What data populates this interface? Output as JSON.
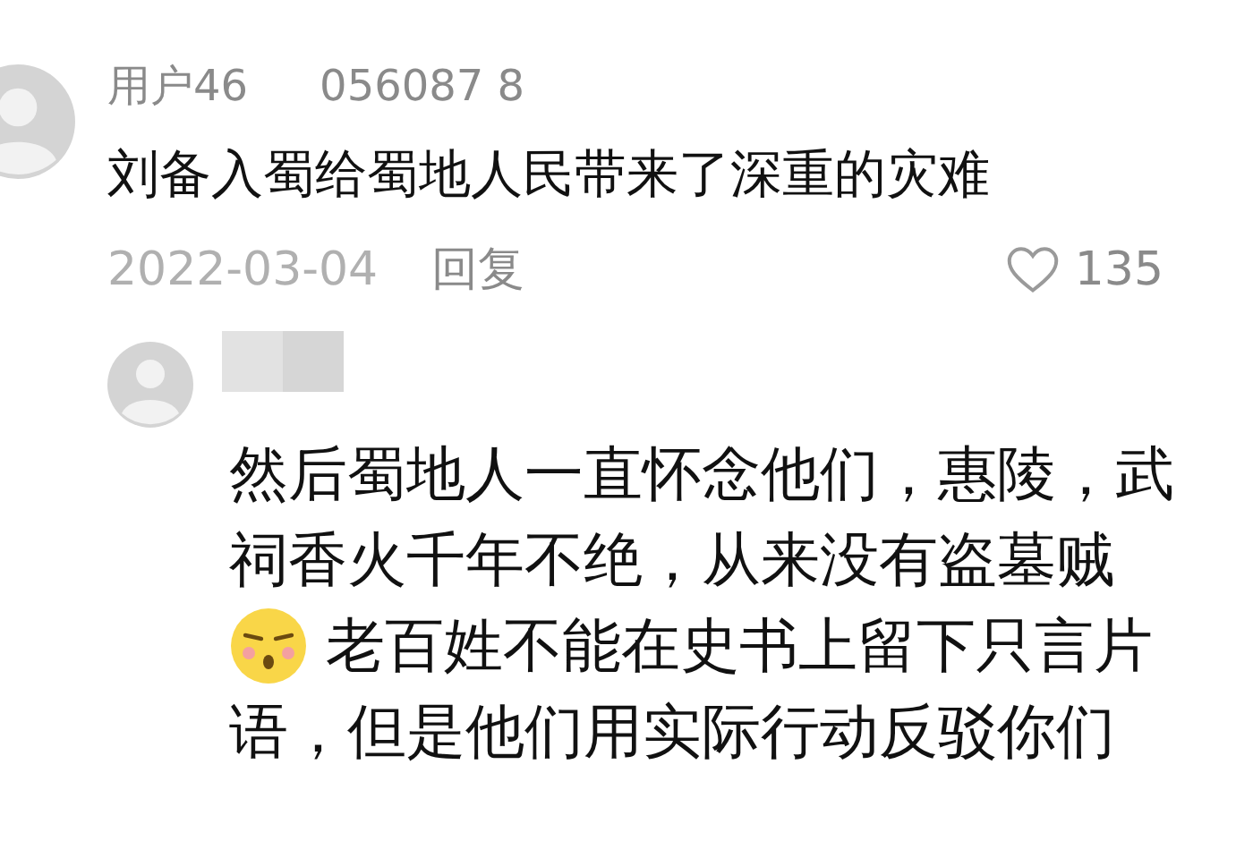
{
  "comment": {
    "username": "用户46",
    "meta": "056087 8",
    "text": "刘备入蜀给蜀地人民带来了深重的灾难",
    "date": "2022-03-04",
    "reply_label": "回复",
    "likes": "135",
    "liked": false
  },
  "reply": {
    "lines": [
      {
        "kind": "text",
        "text": "然后蜀地人一直怀念他们，惠陵，武"
      },
      {
        "kind": "text",
        "text": "祠香火千年不绝，从来没有盗墓贼"
      },
      {
        "kind": "emoji",
        "text": "老百姓不能在史书上留下只言片"
      },
      {
        "kind": "text",
        "text": "语，但是他们用实际行动反驳你们"
      }
    ]
  }
}
